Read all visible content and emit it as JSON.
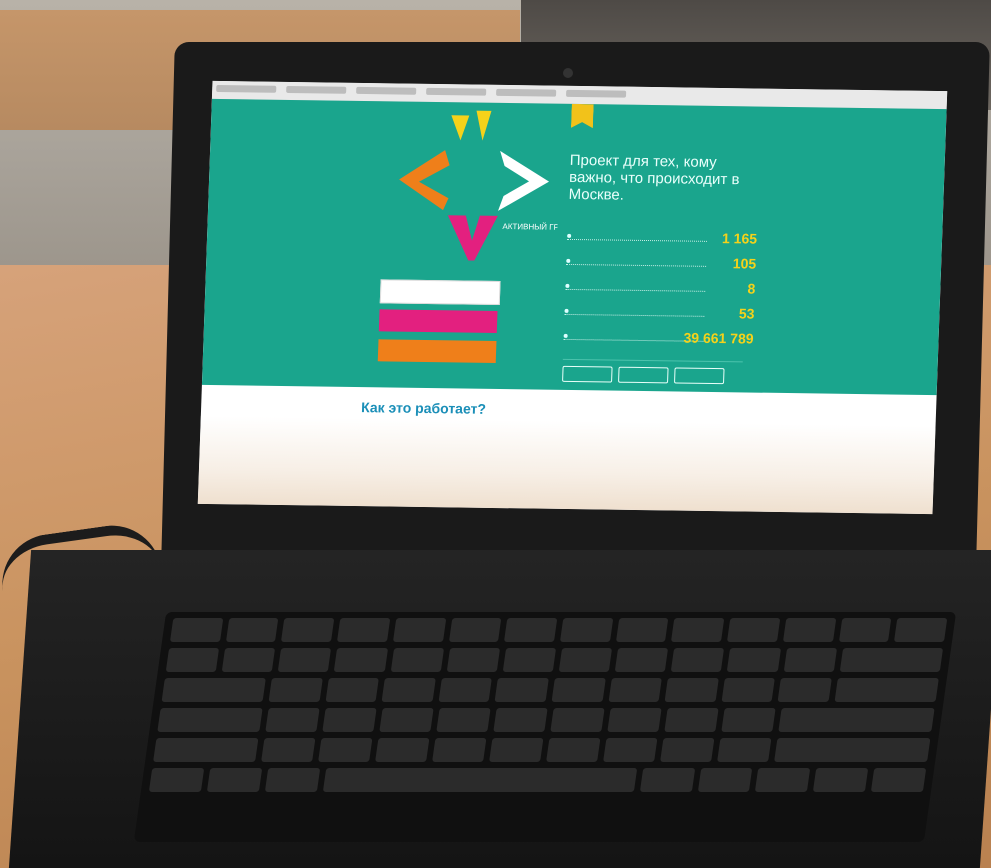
{
  "scene": {
    "description_colors": {
      "desk": "#c9935f",
      "laptop": "#1a1a1a",
      "site_teal": "#1aa58d",
      "accent_yellow": "#f5d21a",
      "accent_pink": "#e3207f",
      "accent_orange": "#ef7f1a"
    }
  },
  "website": {
    "tagline": "Проект для тех, кому важно, что происходит в Москве.",
    "stats": [
      {
        "value": "1 165"
      },
      {
        "value": "105"
      },
      {
        "value": "8"
      },
      {
        "value": "53"
      },
      {
        "value": "39 661 789"
      }
    ],
    "buttons": {
      "primary": "",
      "secondary": "",
      "tertiary": ""
    },
    "how_it_works": "Как это работает?",
    "logo_text": "АКТИВНЫЙ ГРАЖДАНИН"
  }
}
